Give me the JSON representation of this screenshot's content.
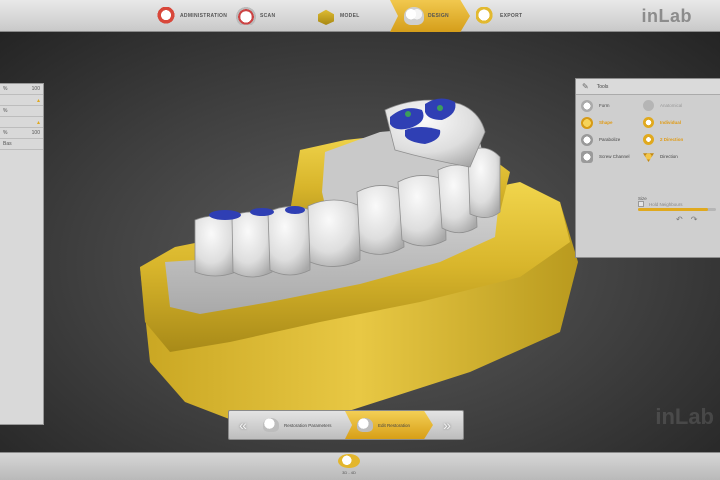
{
  "app": {
    "brand": "inLab",
    "watermark": "inLab"
  },
  "workflow_steps": [
    {
      "label": "ADMINISTRATION",
      "icon": "admin-icon",
      "active": false
    },
    {
      "label": "SCAN",
      "icon": "scan-icon",
      "active": false
    },
    {
      "label": "MODEL",
      "icon": "model-icon",
      "active": false
    },
    {
      "label": "DESIGN",
      "icon": "design-icon",
      "active": true
    },
    {
      "label": "EXPORT",
      "icon": "export-icon",
      "active": false
    }
  ],
  "right_panel": {
    "header": "Tools",
    "tools": [
      {
        "label": "Form",
        "icon": "form-icon",
        "active": false
      },
      {
        "label": "Shape",
        "icon": "shape-icon",
        "active": true
      },
      {
        "label": "Parabolize",
        "icon": "parabolize-icon",
        "active": false
      },
      {
        "label": "Screw Channel",
        "icon": "screw-channel-icon",
        "active": false
      }
    ],
    "options": [
      {
        "label": "Anatomical",
        "icon": "anatomical-icon",
        "state": "dim"
      },
      {
        "label": "Individual",
        "icon": "individual-icon",
        "state": "active"
      },
      {
        "label": "2 Direction",
        "icon": "direction-2-icon",
        "state": "active"
      },
      {
        "label": "Direction",
        "icon": "direction-icon",
        "state": "normal"
      }
    ],
    "size_label": "Size",
    "size_value": 0.9,
    "hold_label": "Hold Neighbours"
  },
  "left_panel": {
    "rows": [
      {
        "label": "%",
        "value": "100"
      },
      {
        "label": "",
        "value": ""
      },
      {
        "label": "%",
        "value": ""
      },
      {
        "label": "",
        "value": ""
      },
      {
        "label": "%",
        "value": "100"
      },
      {
        "label": "Bas",
        "value": ""
      }
    ]
  },
  "subnav": {
    "prev": "«",
    "next": "»",
    "steps": [
      {
        "label": "Restoration Parameters",
        "active": false
      },
      {
        "label": "Edit Restoration",
        "active": true
      }
    ]
  },
  "bottom": {
    "label": "3D - 4D"
  },
  "colors": {
    "accent": "#e0a91e",
    "model_gold": "#e5c23a",
    "tooth_white": "#dcdcdc",
    "prep_blue": "#2f3fb4"
  }
}
